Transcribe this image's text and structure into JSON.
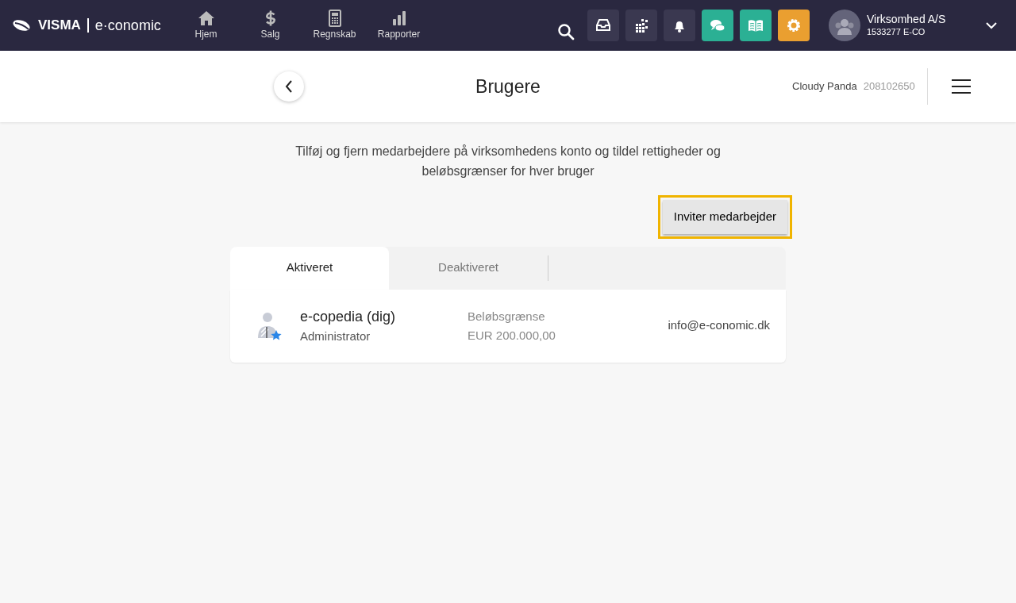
{
  "logo": {
    "brand": "VISMA",
    "product": "e·conomic"
  },
  "nav": [
    {
      "label": "Hjem",
      "kind": "home"
    },
    {
      "label": "Salg",
      "kind": "dollar"
    },
    {
      "label": "Regnskab",
      "kind": "calculator"
    },
    {
      "label": "Rapporter",
      "kind": "bars"
    }
  ],
  "toolbar": [
    {
      "kind": "inbox",
      "color": "#3a3850"
    },
    {
      "kind": "apps",
      "color": "#3a3850"
    },
    {
      "kind": "bell",
      "color": "#3a3850"
    },
    {
      "kind": "chat",
      "color": "#2bb094"
    },
    {
      "kind": "book",
      "color": "#2bb094"
    },
    {
      "kind": "gear",
      "color": "#ea9f30"
    }
  ],
  "account": {
    "company": "Virksomhed A/S",
    "number": "1533277 E-CO"
  },
  "header": {
    "title": "Brugere",
    "user": "Cloudy Panda",
    "user_id": "208102650"
  },
  "intro": "Tilføj og fjern medarbejdere på virksomhedens konto og tildel rettigheder og beløbsgrænser for hver bruger",
  "invite_button": "Inviter medarbejder",
  "tabs": [
    {
      "label": "Aktiveret",
      "selected": true
    },
    {
      "label": "Deaktiveret",
      "selected": false
    }
  ],
  "users": [
    {
      "name": "e-copedia (dig)",
      "role": "Administrator",
      "limit_label": "Beløbsgrænse",
      "limit": "EUR 200.000,00",
      "email": "info@e-conomic.dk"
    }
  ]
}
